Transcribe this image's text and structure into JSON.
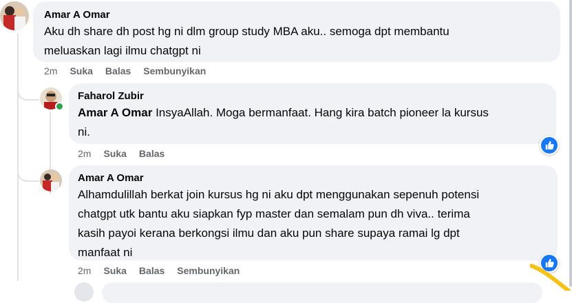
{
  "comments": [
    {
      "author": "Amar A Omar",
      "text": "Aku dh share dh post hg ni dlm group study MBA aku.. semoga dpt membantu meluaskan lagi ilmu chatgpt ni",
      "line1": "Aku dh share dh post hg ni dlm group study MBA aku.. semoga dpt membantu",
      "line2": "meluaskan lagi ilmu chatgpt ni",
      "time": "2m",
      "like": "Suka",
      "reply": "Balas",
      "hide": "Sembunyikan"
    },
    {
      "author": "Faharol Zubir",
      "mention": "Amar A Omar",
      "line1": "InsyaAllah. Moga bermanfaat. Hang kira batch pioneer la kursus",
      "line2": "ni.",
      "time": "2m",
      "like": "Suka",
      "reply": "Balas",
      "reaction_icon": "thumbs-up-icon"
    },
    {
      "author": "Amar A Omar",
      "line1": "Alhamdulillah berkat join kursus hg ni aku dpt menggunakan sepenuh potensi",
      "line2": "chatgpt utk bantu aku siapkan fyp master dan semalam pun dh viva.. terima",
      "line3": "kasih payoi kerana berkongsi ilmu dan aku pun share supaya ramai lg dpt",
      "line4": "manfaat ni",
      "time": "2m",
      "like": "Suka",
      "reply": "Balas",
      "hide": "Sembunyikan",
      "reaction_icon": "thumbs-up-icon"
    }
  ],
  "colors": {
    "bubble": "#f0f2f5",
    "meta": "#65676b",
    "like_blue": "#1877f2",
    "online": "#31a24c"
  }
}
